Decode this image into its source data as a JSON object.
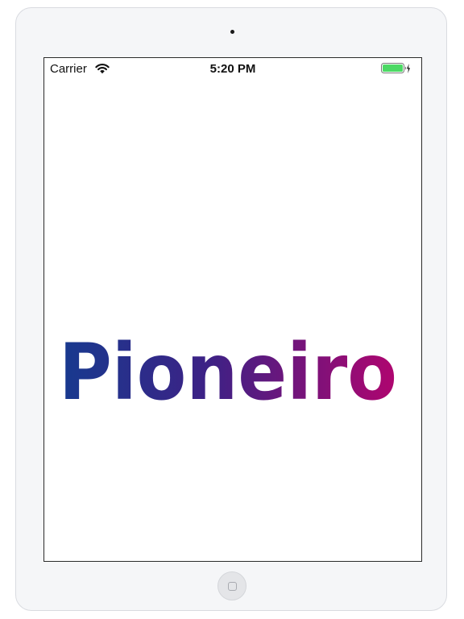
{
  "status_bar": {
    "carrier": "Carrier",
    "time": "5:20 PM",
    "wifi_icon": "wifi-icon",
    "battery_icon": "battery-charging-icon",
    "battery_fill_fraction": 1.0,
    "battery_color": "#4cd964"
  },
  "splash": {
    "logo_text": "Pioneiro",
    "logo_gradient_start": "#173a8f",
    "logo_gradient_end": "#b0056f"
  },
  "device": {
    "home_button_icon": "home-button-icon"
  }
}
